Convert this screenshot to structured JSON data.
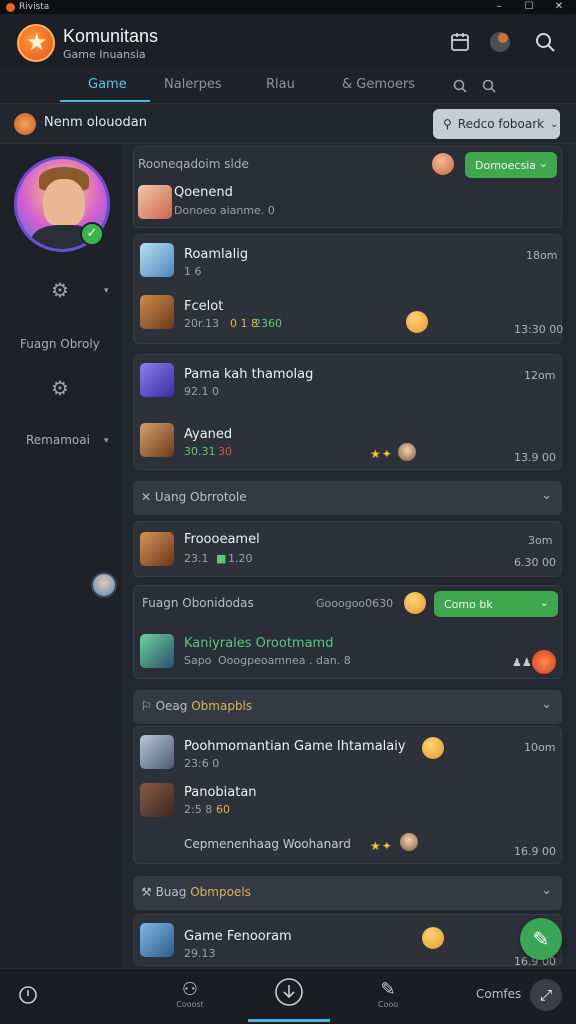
{
  "window": {
    "title": "Rivista"
  },
  "header": {
    "title": "Komunitans",
    "subtitle": "Game Inuansia",
    "icons": [
      "calendar-icon",
      "profile-icon",
      "search-icon"
    ]
  },
  "tabs": [
    {
      "label": "Game",
      "active": true
    },
    {
      "label": "Nalerpes",
      "active": false
    },
    {
      "label": "Rlau",
      "active": false
    },
    {
      "label": "& Gemoers",
      "active": false
    }
  ],
  "filter": {
    "label": "Nenm olouodan",
    "button_label": "Redco foboark"
  },
  "sidebar": {
    "label_1": "Fuagn Obroly",
    "label_2": "Remamoai"
  },
  "top_card": {
    "title": "Rooneqadoim slde",
    "pill_label": "Domoecsia",
    "item_title": "Qoenend",
    "item_sub": "Donoeo aianme. 0"
  },
  "card_a": {
    "title": "Roamlalig",
    "sub": "1 6",
    "time": "18om",
    "item2_title": "Fcelot",
    "item2_sub_a": "20r.13",
    "item2_sub_b": "0 1 8",
    "item2_sub_c": "2360",
    "item2_time": "13:30 00"
  },
  "card_b": {
    "title": "Pama kah thamolag",
    "sub": "92.1 0",
    "time": "12om",
    "item2_title": "Ayaned",
    "item2_sub_a": "30.31",
    "item2_sub_b": "30",
    "item2_time": "13.9 00"
  },
  "section_1": {
    "title": "Uang Obrrotole"
  },
  "card_c": {
    "title": "Froooeamel",
    "sub_a": "23.1",
    "sub_b": "1.20",
    "time_top": "3om",
    "time": "6.30 00"
  },
  "card_d": {
    "header": "Fuagn Obonidodas",
    "header_right": "Gooogoo0630",
    "pill_label": "Como bk",
    "item_title": "Kaniyrales Orootmamd",
    "item_sub_a": "Sapo",
    "item_sub_b": "Ooogpeoamnea . dan. 8"
  },
  "section_2": {
    "title_a": "Oeag",
    "title_b": "Obmapbls"
  },
  "card_e": {
    "item1_title": "Poohmomantian Game Ihtamalaiy",
    "item1_sub": "23:6 0",
    "item1_time": "10om",
    "item2_title": "Panobiatan",
    "item2_sub_a": "2:5 8",
    "item2_sub_b": "60",
    "item3_title": "Cepmenenhaag Woohanard",
    "item3_time": "16.9 00"
  },
  "section_3": {
    "title_a": "Buag",
    "title_b": "Obmpoels"
  },
  "card_f": {
    "title": "Game Fenooram",
    "sub": "29.13",
    "time": "16.9 00"
  },
  "bottom": {
    "item_1": "Cooost",
    "item_2": "Cooo",
    "label": "Comfes"
  }
}
